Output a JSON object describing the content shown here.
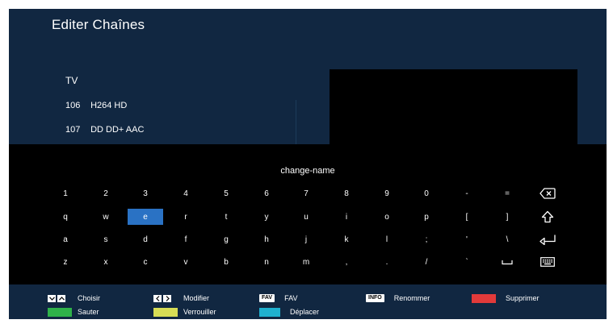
{
  "header": {
    "title": "Editer Chaînes"
  },
  "channel_list": {
    "group": "TV",
    "rows": [
      {
        "number": "106",
        "name": "H264 HD"
      },
      {
        "number": "107",
        "name": "DD DD+ AAC"
      }
    ]
  },
  "keyboard": {
    "input_value": "change-name",
    "selected_key": "e",
    "rows": [
      [
        "1",
        "2",
        "3",
        "4",
        "5",
        "6",
        "7",
        "8",
        "9",
        "0",
        "-",
        "="
      ],
      [
        "q",
        "w",
        "e",
        "r",
        "t",
        "y",
        "u",
        "i",
        "o",
        "p",
        "[",
        "]"
      ],
      [
        "a",
        "s",
        "d",
        "f",
        "g",
        "h",
        "j",
        "k",
        "l",
        ";",
        "'",
        "\\"
      ],
      [
        "z",
        "x",
        "c",
        "v",
        "b",
        "n",
        "m",
        ",",
        ".",
        "/",
        "`",
        ""
      ]
    ],
    "special_keys": [
      "backspace-icon",
      "shift-icon",
      "enter-icon",
      "space-icon",
      "keyboard-icon"
    ]
  },
  "legend": {
    "choose": {
      "label": "Choisir",
      "icon": "up-down-arrows-icon"
    },
    "modify": {
      "label": "Modifier",
      "icon": "left-right-arrows-icon"
    },
    "fav": {
      "tag": "FAV",
      "label": "FAV"
    },
    "info": {
      "tag": "INFO",
      "label": "Renommer"
    },
    "delete": {
      "label": "Supprimer",
      "color": "#e23a3a"
    },
    "skip": {
      "label": "Sauter",
      "color": "#2fb24a"
    },
    "lock": {
      "label": "Verrouiller",
      "color": "#d7dd55"
    },
    "move": {
      "label": "Déplacer",
      "color": "#1fb1cf"
    }
  },
  "colors": {
    "background": "#112741",
    "panel": "#000000",
    "selected_key": "#2a72c4"
  }
}
